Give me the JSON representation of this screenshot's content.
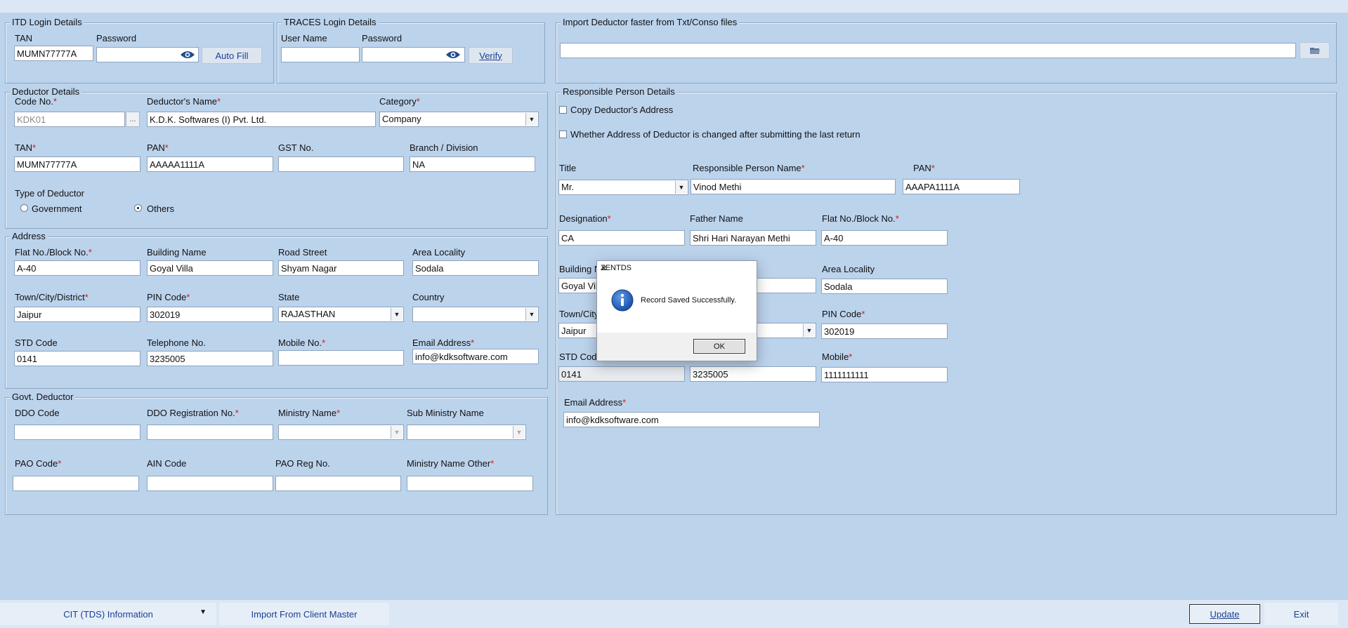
{
  "itd": {
    "legend": "ITD Login Details",
    "tan_label": "TAN",
    "tan_value": "MUMN77777A",
    "password_label": "Password",
    "password_value": "",
    "autofill_label": "Auto Fill"
  },
  "traces": {
    "legend": "TRACES Login Details",
    "username_label": "User Name",
    "username_value": "",
    "password_label": "Password",
    "password_value": "",
    "verify_label": "Verify"
  },
  "import_files": {
    "legend": "Import Deductor faster from Txt/Conso files",
    "path_value": ""
  },
  "deductor": {
    "legend": "Deductor Details",
    "code_label": "Code No.",
    "code_value": "KDK01",
    "lookup_label": "...",
    "name_label": "Deductor's Name",
    "name_value": "K.D.K. Softwares (I) Pvt. Ltd.",
    "category_label": "Category",
    "category_value": "Company",
    "tan_label": "TAN",
    "tan_value": "MUMN77777A",
    "pan_label": "PAN",
    "pan_value": "AAAAA1111A",
    "gst_label": "GST No.",
    "gst_value": "",
    "branch_label": "Branch / Division",
    "branch_value": "NA",
    "type_label": "Type of Deductor",
    "type_options": [
      "Government",
      "Others"
    ],
    "type_selected": "Others"
  },
  "address": {
    "legend": "Address",
    "flat_label": "Flat No./Block No.",
    "flat_value": "A-40",
    "building_label": "Building Name",
    "building_value": "Goyal Villa",
    "road_label": "Road Street",
    "road_value": "Shyam Nagar",
    "area_label": "Area Locality",
    "area_value": "Sodala",
    "town_label": "Town/City/District",
    "town_value": "Jaipur",
    "pin_label": "PIN Code",
    "pin_value": "302019",
    "state_label": "State",
    "state_value": "RAJASTHAN",
    "country_label": "Country",
    "country_value": "",
    "std_label": "STD Code",
    "std_value": "0141",
    "tel_label": "Telephone No.",
    "tel_value": "3235005",
    "mobile_label": "Mobile No.",
    "mobile_value": "",
    "email_label": "Email Address",
    "email_value": "info@kdksoftware.com"
  },
  "govt": {
    "legend": "Govt. Deductor",
    "ddo_code_label": "DDO Code",
    "ddo_reg_label": "DDO Registration No.",
    "ministry_label": "Ministry Name",
    "sub_ministry_label": "Sub Ministry Name",
    "pao_code_label": "PAO Code",
    "ain_label": "AIN Code",
    "pao_reg_label": "PAO Reg No.",
    "ministry_other_label": "Ministry Name Other"
  },
  "responsible": {
    "legend": "Responsible Person Details",
    "copy_address_label": "Copy Deductor's Address",
    "address_changed_label": "Whether Address of Deductor is changed after submitting the last return",
    "title_label": "Title",
    "title_value": "Mr.",
    "name_label": "Responsible Person Name",
    "name_value": "Vinod Methi",
    "pan_label": "PAN",
    "pan_value": "AAAPA1111A",
    "designation_label": "Designation",
    "designation_value": "CA",
    "father_label": "Father Name",
    "father_value": "Shri Hari Narayan Methi",
    "flat_label": "Flat No./Block No.",
    "flat_value": "A-40",
    "building_label_partial": "Building N",
    "building_value_partial": "Goyal Vil",
    "area_label": "Area Locality",
    "area_value": "Sodala",
    "town_label_partial": "Town/City",
    "town_value": "Jaipur",
    "pin_label": "PIN Code",
    "pin_value": "302019",
    "std_label_partial": "STD Cod",
    "std_value": "0141",
    "tel_value": "3235005",
    "mobile_label": "Mobile",
    "mobile_value": "1111111111",
    "email_label": "Email Address",
    "email_value": "info@kdksoftware.com"
  },
  "dialog": {
    "title": "ZENTDS",
    "message": "Record Saved Successfully.",
    "ok_label": "OK"
  },
  "footer": {
    "cit_label": "CIT (TDS) Information",
    "import_client_label": "Import From Client Master",
    "update_label": "Update",
    "exit_label": "Exit"
  },
  "colors": {
    "background": "#bcd3ec",
    "required_mark": "#d21c1c",
    "link_text": "#1c3f91"
  }
}
